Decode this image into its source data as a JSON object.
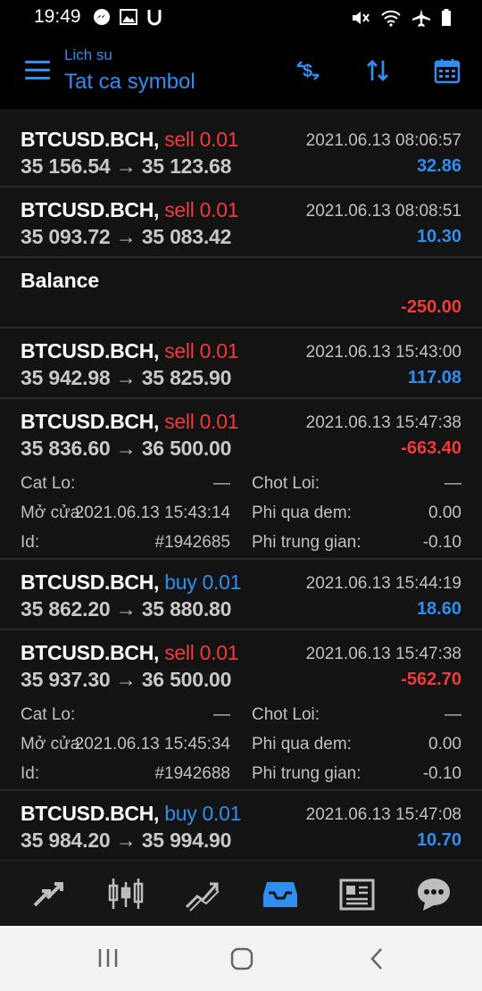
{
  "status": {
    "time": "19:49"
  },
  "header": {
    "subtitle": "Lich su",
    "title": "Tat ca symbol"
  },
  "trades": [
    {
      "symbol": "BTCUSD.BCH,",
      "side": "sell 0.01",
      "time": "2021.06.13 08:06:57",
      "prices": "35 156.54 → 35 123.68",
      "profit": "32.86"
    },
    {
      "symbol": "BTCUSD.BCH,",
      "side": "sell 0.01",
      "time": "2021.06.13 08:08:51",
      "prices": "35 093.72 → 35 083.42",
      "profit": "10.30"
    },
    {
      "label": "Balance",
      "profit": "-250.00"
    },
    {
      "symbol": "BTCUSD.BCH,",
      "side": "sell 0.01",
      "time": "2021.06.13 15:43:00",
      "prices": "35 942.98 → 35 825.90",
      "profit": "117.08"
    },
    {
      "symbol": "BTCUSD.BCH,",
      "side": "sell 0.01",
      "time": "2021.06.13 15:47:38",
      "prices": "35 836.60 → 36 500.00",
      "profit": "-663.40",
      "details": {
        "sl_label": "Cat Lo:",
        "sl_value": "—",
        "tp_label": "Chot Loi:",
        "tp_value": "—",
        "open_label": "Mở cửa:",
        "open_value": "2021.06.13 15:43:14",
        "swap_label": "Phi qua dem:",
        "swap_value": "0.00",
        "id_label": "Id:",
        "id_value": "#1942685",
        "comm_label": "Phi trung gian:",
        "comm_value": "-0.10"
      }
    },
    {
      "symbol": "BTCUSD.BCH,",
      "side": "buy 0.01",
      "time": "2021.06.13 15:44:19",
      "prices": "35 862.20 → 35 880.80",
      "profit": "18.60"
    },
    {
      "symbol": "BTCUSD.BCH,",
      "side": "sell 0.01",
      "time": "2021.06.13 15:47:38",
      "prices": "35 937.30 → 36 500.00",
      "profit": "-562.70",
      "details": {
        "sl_label": "Cat Lo:",
        "sl_value": "—",
        "tp_label": "Chot Loi:",
        "tp_value": "—",
        "open_label": "Mở cửa:",
        "open_value": "2021.06.13 15:45:34",
        "swap_label": "Phi qua dem:",
        "swap_value": "0.00",
        "id_label": "Id:",
        "id_value": "#1942688",
        "comm_label": "Phi trung gian:",
        "comm_value": "-0.10"
      }
    },
    {
      "symbol": "BTCUSD.BCH,",
      "side": "buy 0.01",
      "time": "2021.06.13 15:47:08",
      "prices": "35 984.20 → 35 994.90",
      "profit": "10.70"
    }
  ],
  "colors": {
    "accent": "#2f8ef0",
    "loss": "#f33a3a",
    "background": "#131313"
  },
  "icons": {
    "header_actions": [
      "dollar-swap-icon",
      "sort-icon",
      "calendar-icon"
    ],
    "bottom_nav": [
      "quotes-arrows-icon",
      "candlestick-chart-icon",
      "trade-chart-icon",
      "history-inbox-icon",
      "news-icon",
      "chat-icon"
    ],
    "active_nav": "history-inbox-icon"
  }
}
